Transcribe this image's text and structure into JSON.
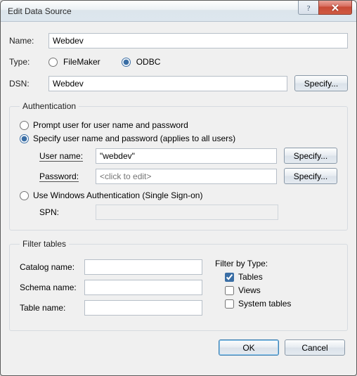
{
  "window": {
    "title": "Edit Data Source"
  },
  "form": {
    "name_label": "Name:",
    "name_value": "Webdev",
    "type_label": "Type:",
    "type_options": {
      "filemaker": "FileMaker",
      "odbc": "ODBC"
    },
    "dsn_label": "DSN:",
    "dsn_value": "Webdev",
    "specify_btn": "Specify..."
  },
  "auth": {
    "legend": "Authentication",
    "prompt": "Prompt user for user name and password",
    "specify": "Specify user name and password (applies to all users)",
    "user_label": "User name:",
    "user_value": "\"webdev\"",
    "pass_label": "Password:",
    "pass_placeholder": "<click to edit>",
    "winauth": "Use Windows Authentication (Single Sign-on)",
    "spn_label": "SPN:",
    "specify_btn": "Specify..."
  },
  "filter": {
    "legend": "Filter tables",
    "catalog": "Catalog name:",
    "schema": "Schema name:",
    "table": "Table name:",
    "bytype": "Filter by Type:",
    "tables": "Tables",
    "views": "Views",
    "systables": "System tables"
  },
  "footer": {
    "ok": "OK",
    "cancel": "Cancel"
  }
}
